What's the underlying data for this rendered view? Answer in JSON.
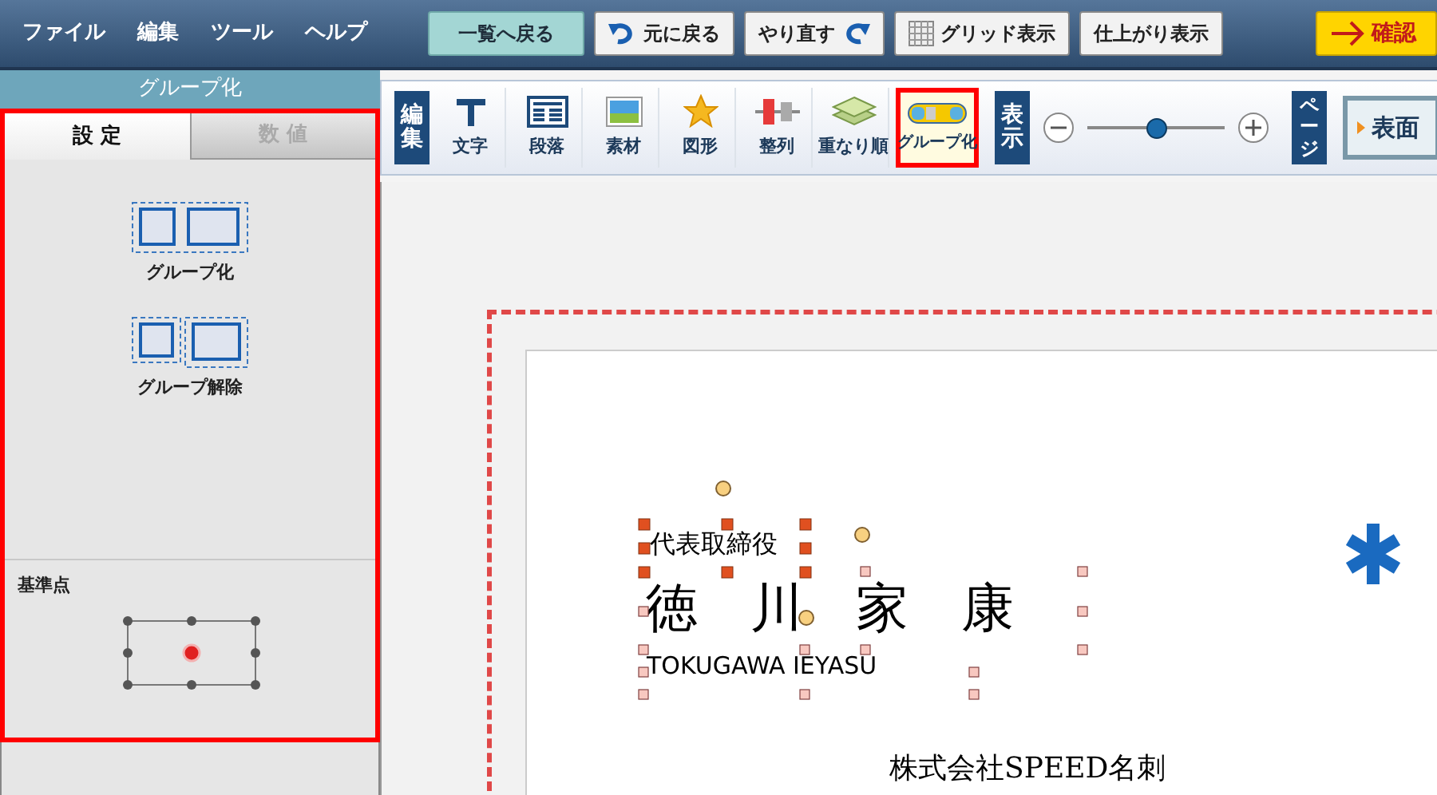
{
  "menu": [
    "ファイル",
    "編集",
    "ツール",
    "ヘルプ"
  ],
  "top_buttons": [
    {
      "label": "一覧へ戻る",
      "kind": "back"
    },
    {
      "label": "元に戻る",
      "kind": "undo"
    },
    {
      "label": "やり直す",
      "kind": "redo"
    },
    {
      "label": "グリッド表示",
      "kind": "grid"
    },
    {
      "label": "仕上がり表示",
      "kind": "plain"
    },
    {
      "label": "確認",
      "kind": "confirm"
    }
  ],
  "side_panel": {
    "title": "グループ化",
    "tabs": [
      {
        "label": "設 定",
        "selected": true
      },
      {
        "label": "数 値",
        "selected": false
      }
    ],
    "actions": [
      {
        "label": "グループ化",
        "kind": "group"
      },
      {
        "label": "グループ解除",
        "kind": "ungroup"
      }
    ],
    "anchor_label": "基準点"
  },
  "toolbar": {
    "edit_label": "編集",
    "tools": [
      {
        "label": "文字",
        "kind": "text",
        "selected": false
      },
      {
        "label": "段落",
        "kind": "paragraph",
        "selected": false
      },
      {
        "label": "素材",
        "kind": "image",
        "selected": false
      },
      {
        "label": "図形",
        "kind": "shape",
        "selected": false
      },
      {
        "label": "整列",
        "kind": "align",
        "selected": false
      },
      {
        "label": "重なり順",
        "kind": "order",
        "selected": false
      },
      {
        "label": "グループ化",
        "kind": "group",
        "selected": true
      }
    ],
    "view_label": "表示",
    "zoom": {
      "level": 0.5
    },
    "page_label": "ページ",
    "page_button": "表面"
  },
  "card": {
    "title": "代表取締役",
    "name": "徳　川　家　康",
    "romaji": "TOKUGAWA IEYASU",
    "company": "株式会社SPEED名刺"
  }
}
